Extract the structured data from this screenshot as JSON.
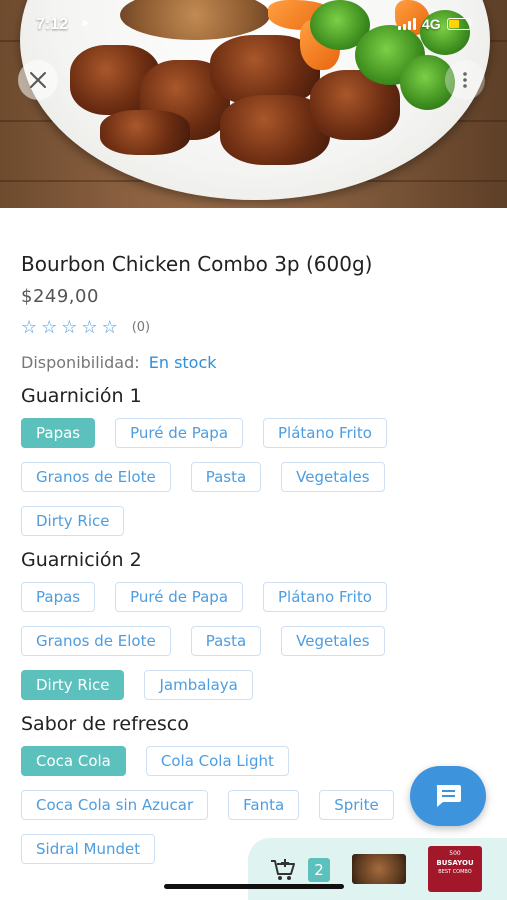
{
  "status_bar": {
    "time": "7:12",
    "network": "4G"
  },
  "product": {
    "title": "Bourbon Chicken Combo 3p (600g)",
    "price": "$249,00",
    "rating_value": 0,
    "rating_count": "(0)",
    "availability_label": "Disponibilidad:",
    "availability_value": "En stock"
  },
  "options": [
    {
      "title": "Guarnición 1",
      "choices": [
        {
          "label": "Papas",
          "selected": true
        },
        {
          "label": "Puré de Papa",
          "selected": false
        },
        {
          "label": "Plátano Frito",
          "selected": false
        },
        {
          "label": "Granos de Elote",
          "selected": false
        },
        {
          "label": "Pasta",
          "selected": false
        },
        {
          "label": "Vegetales",
          "selected": false
        },
        {
          "label": "Dirty Rice",
          "selected": false
        }
      ]
    },
    {
      "title": "Guarnición 2",
      "choices": [
        {
          "label": "Papas",
          "selected": false
        },
        {
          "label": "Puré de Papa",
          "selected": false
        },
        {
          "label": "Plátano Frito",
          "selected": false
        },
        {
          "label": "Granos de Elote",
          "selected": false
        },
        {
          "label": "Pasta",
          "selected": false
        },
        {
          "label": "Vegetales",
          "selected": false
        },
        {
          "label": "Dirty Rice",
          "selected": true
        },
        {
          "label": "Jambalaya",
          "selected": false
        }
      ]
    },
    {
      "title": "Sabor de refresco",
      "choices": [
        {
          "label": "Coca Cola",
          "selected": true
        },
        {
          "label": "Cola Cola Light",
          "selected": false
        },
        {
          "label": "Coca Cola sin Azucar",
          "selected": false
        },
        {
          "label": "Fanta",
          "selected": false
        },
        {
          "label": "Sprite",
          "selected": false
        },
        {
          "label": "Sidral Mundet",
          "selected": false
        }
      ]
    }
  ],
  "cart": {
    "count": "2",
    "thumb2_top": "500",
    "thumb2_name": "BUSAYOU",
    "thumb2_sub": "BEST COMBO"
  },
  "icons": {
    "close": "close-icon",
    "more": "more-vertical-icon",
    "chat": "chat-icon",
    "cart": "cart-add-icon",
    "star": "star-outline-icon"
  },
  "colors": {
    "accent_teal": "#5cc0bd",
    "accent_blue": "#4d9de0",
    "fab_blue": "#3d93dc",
    "cart_bar_bg": "#dff3f0"
  }
}
